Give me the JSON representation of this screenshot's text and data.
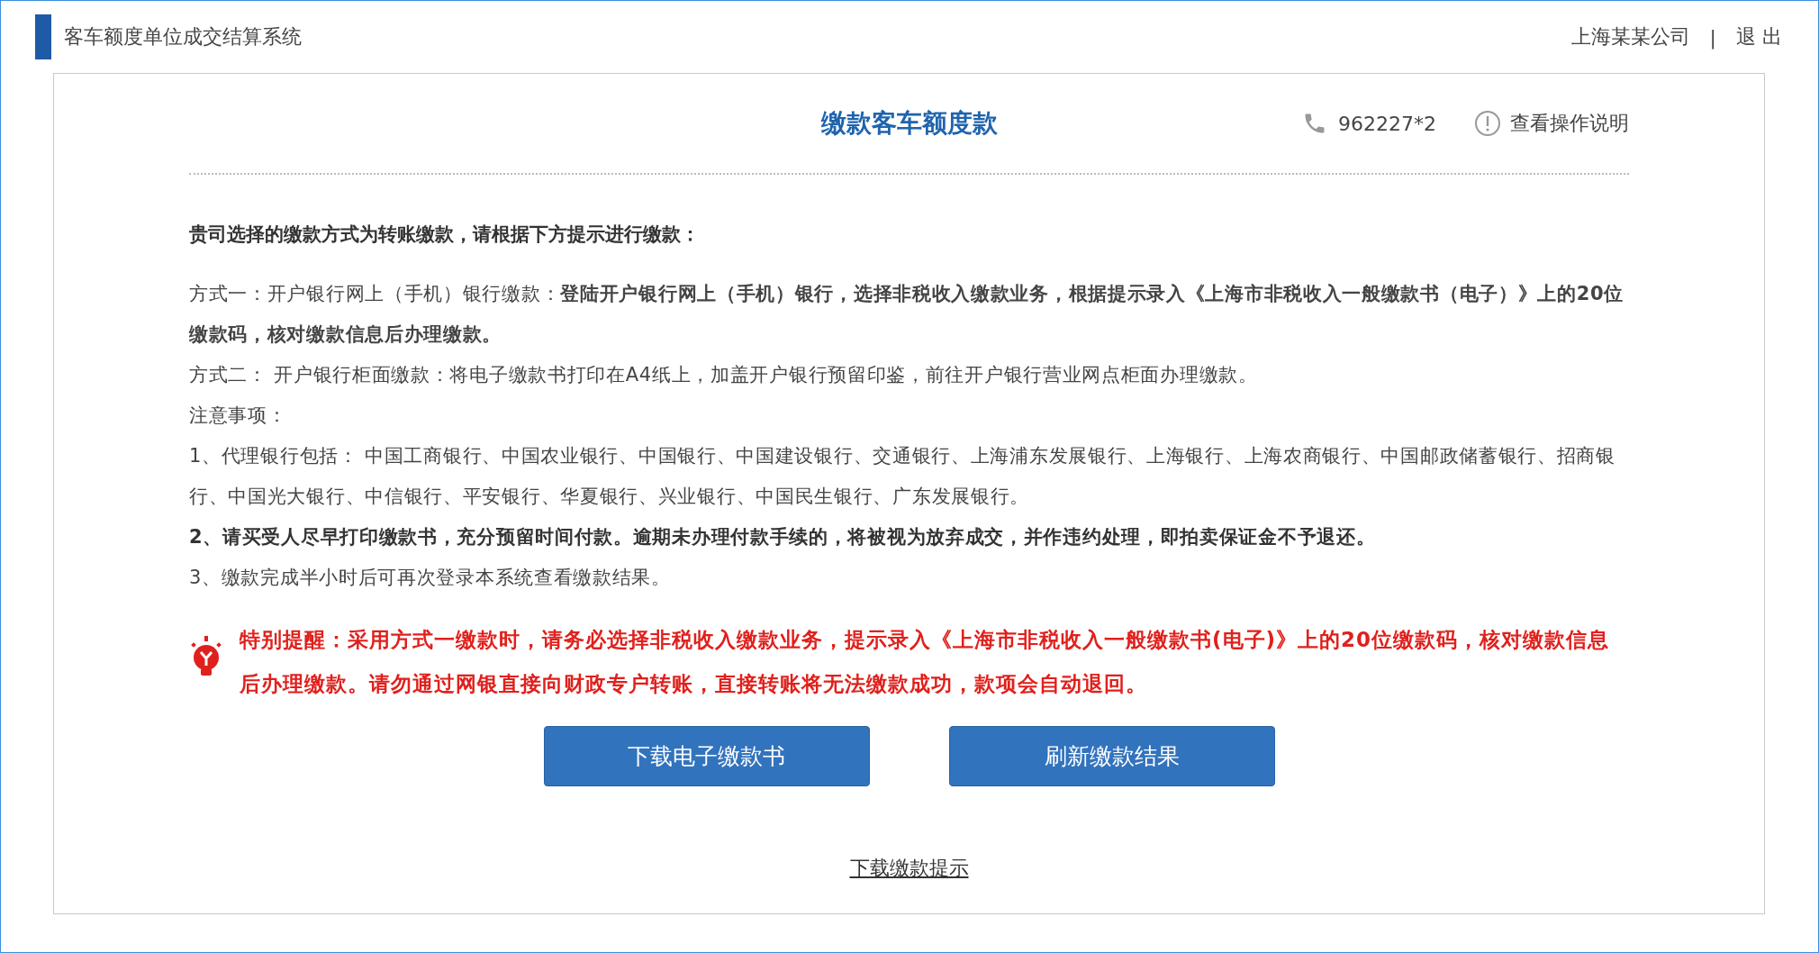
{
  "header": {
    "title": "客车额度单位成交结算系统",
    "company": "上海某某公司",
    "separator": "|",
    "logout": "退 出"
  },
  "card": {
    "title": "缴款客车额度款",
    "phone": "962227*2",
    "help_link": "查看操作说明",
    "intro": "贵司选择的缴款方式为转账缴款，请根据下方提示进行缴款：",
    "paragraphs": [
      {
        "kind": "plain",
        "text": "方式一：开户银行网上（手机）银行缴款：**登陆开户银行网上（手机）银行，选择非税收入缴款业务，根据提示录入《上海市非税收入一般缴款书（电子）》上的20位缴款码，核对缴款信息后办理缴款。**"
      },
      {
        "kind": "plain",
        "text": "方式二： 开户银行柜面缴款：将电子缴款书打印在A4纸上，加盖开户银行预留印鉴，前往开户银行营业网点柜面办理缴款。"
      },
      {
        "kind": "plain",
        "text": "注意事项："
      },
      {
        "kind": "plain",
        "text": "1、代理银行包括： 中国工商银行、中国农业银行、中国银行、中国建设银行、交通银行、上海浦东发展银行、上海银行、上海农商银行、中国邮政储蓄银行、招商银行、中国光大银行、中信银行、平安银行、华夏银行、兴业银行、中国民生银行、广东发展银行。"
      },
      {
        "kind": "bold",
        "text": "2、请买受人尽早打印缴款书，充分预留时间付款。逾期未办理付款手续的，将被视为放弃成交，并作违约处理，即拍卖保证金不予退还。"
      },
      {
        "kind": "plain",
        "text": "3、缴款完成半小时后可再次登录本系统查看缴款结果。"
      }
    ],
    "reminder": "特别提醒：采用方式一缴款时，请务必选择非税收入缴款业务，提示录入《上海市非税收入一般缴款书(电子)》上的20位缴款码，核对缴款信息后办理缴款。请勿通过网银直接向财政专户转账，直接转账将无法缴款成功，款项会自动退回。",
    "buttons": [
      "下载电子缴款书",
      "刷新缴款结果"
    ],
    "download_link": "下载缴款提示"
  }
}
